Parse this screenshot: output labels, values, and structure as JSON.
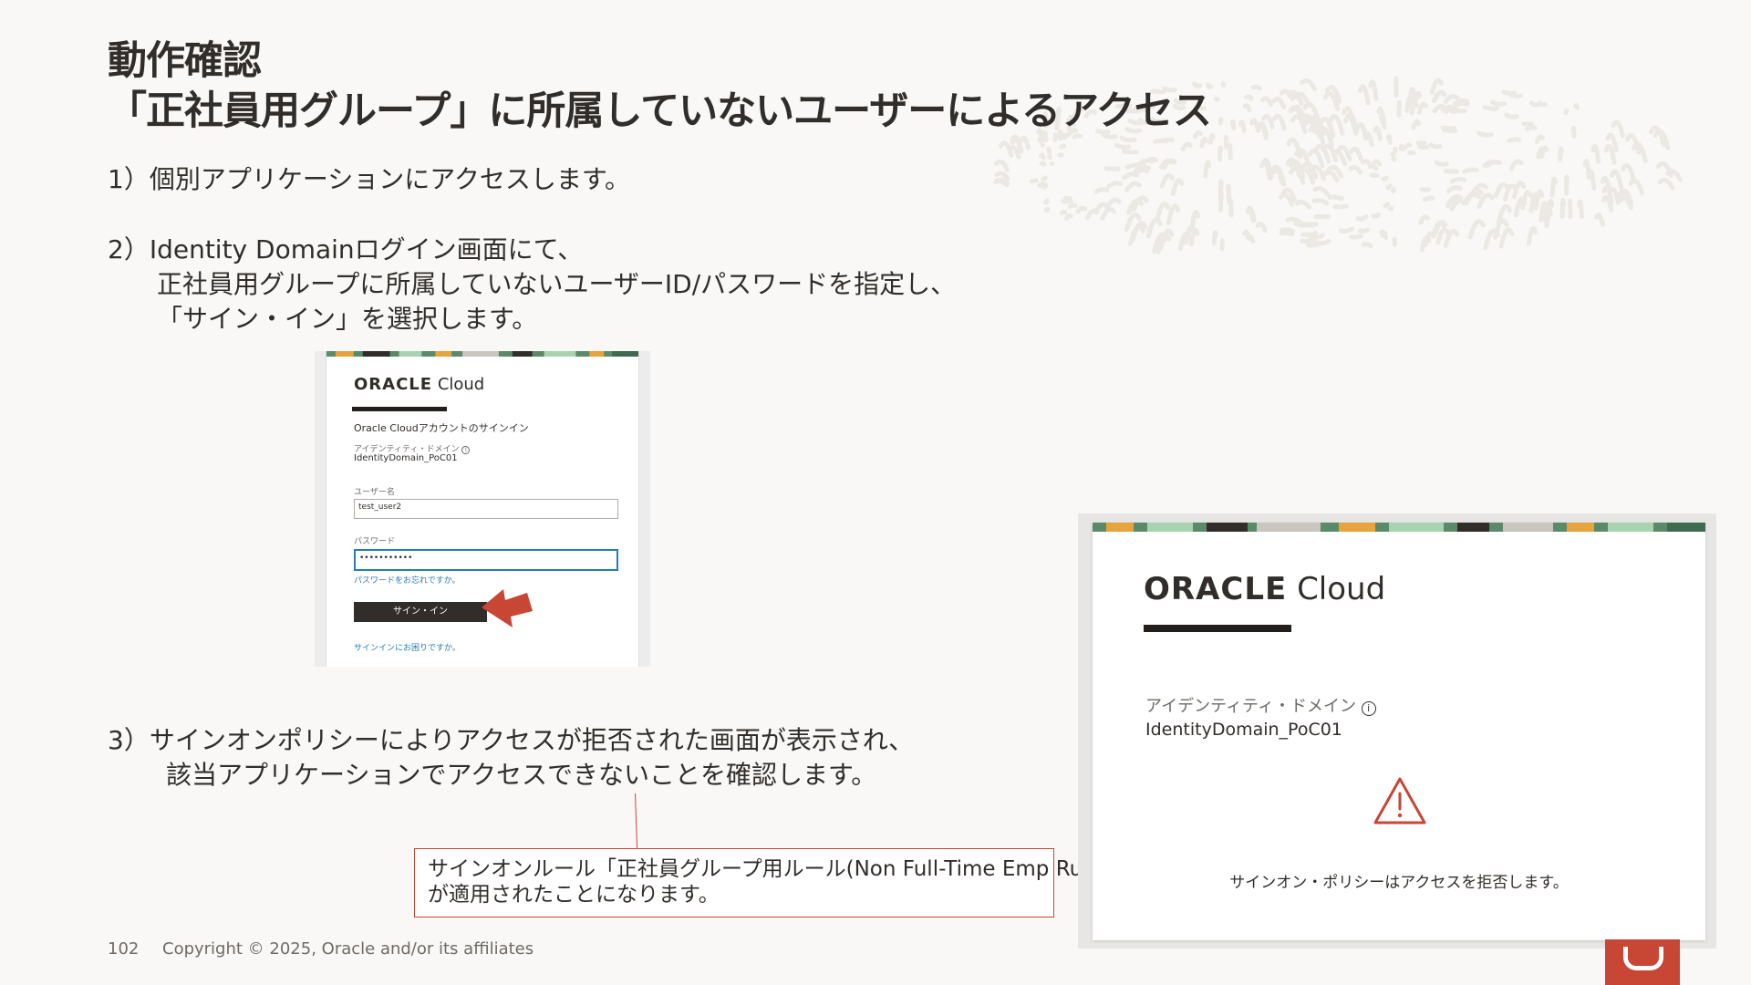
{
  "title": {
    "line1": "動作確認",
    "line2": "「正社員用グループ」に所属していないユーザーによるアクセス"
  },
  "steps": {
    "step1": "1）個別アプリケーションにアクセスします。",
    "step2_line1": "2）Identity Domainログイン画面にて、",
    "step2_line2": "正社員用グループに所属していないユーザーID/パスワードを指定し、",
    "step2_line3": "「サイン・イン」を選択します。",
    "step3_line1": "3）サインオンポリシーによりアクセスが拒否された画面が表示され、",
    "step3_line2": "該当アプリケーションでアクセスできないことを確認します。"
  },
  "login_screen": {
    "logo_oracle": "ORACLE",
    "logo_cloud": "Cloud",
    "heading": "Oracle Cloudアカウントのサインイン",
    "domain_label": "アイデンティティ・ドメイン",
    "domain_info_icon": "info-icon",
    "domain_value": "IdentityDomain_PoC01",
    "username_label": "ユーザー名",
    "username_value": "test_user2",
    "password_label": "パスワード",
    "password_value": "•••••••••••",
    "forgot_password": "パスワードをお忘れですか。",
    "signin_button": "サイン・イン",
    "help_link": "サインインにお困りですか。",
    "arrow_color": "#c74634"
  },
  "callout": {
    "line1": "サインオンルール「正社員グループ用ルール(Non Full-Time Emp Rule)",
    "line2": "が適用されたことになります。"
  },
  "denied_screen": {
    "logo_oracle": "ORACLE",
    "logo_cloud": "Cloud",
    "domain_label": "アイデンティティ・ドメイン",
    "domain_info_icon": "info-icon",
    "domain_value": "IdentityDomain_PoC01",
    "warning_icon": "warning-triangle-icon",
    "message": "サインオン・ポリシーはアクセスを拒否します。"
  },
  "footer": {
    "page_number": "102",
    "copyright": "Copyright © 2025, Oracle and/or its affiliates"
  },
  "colors": {
    "accent": "#c74634",
    "text": "#312d2a",
    "link": "#2a7ab0"
  }
}
